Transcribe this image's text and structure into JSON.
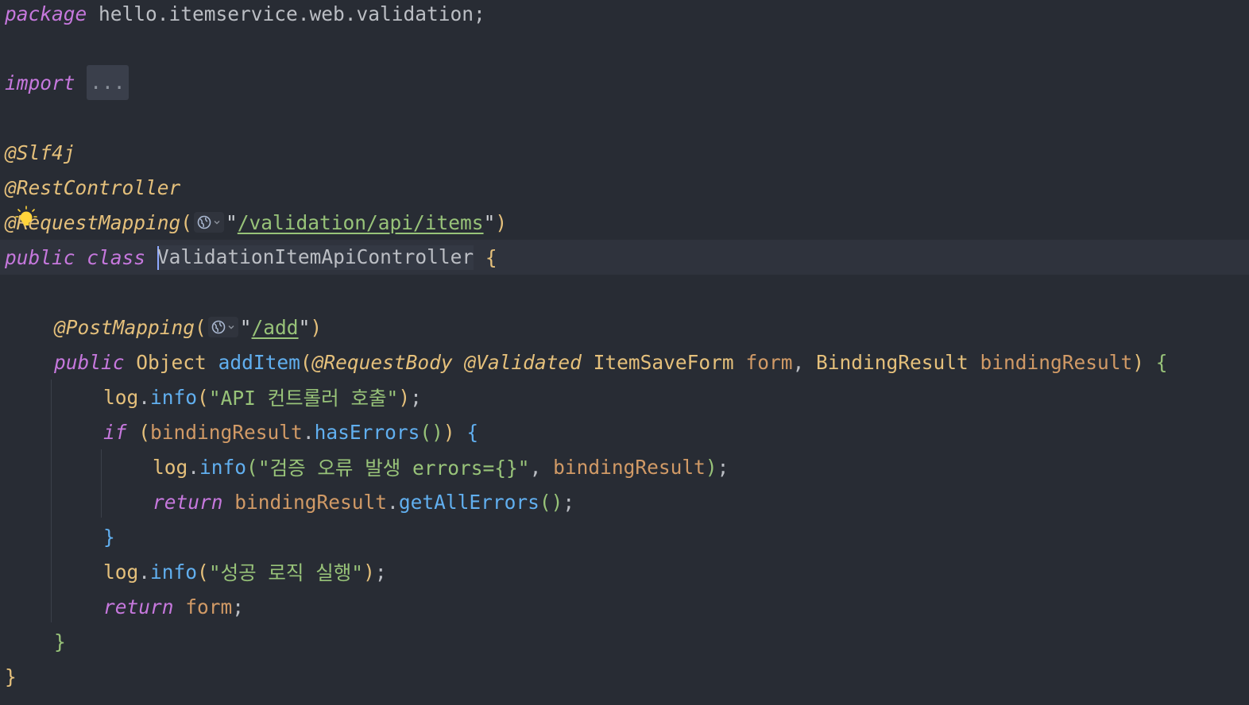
{
  "code": {
    "package_kw": "package",
    "package_name": " hello.itemservice.web.validation",
    "semicolon": ";",
    "import_kw": "import",
    "import_fold": "...",
    "anno_slf4j": "@Slf4j",
    "anno_rest": "@RestController",
    "anno_reqmap": "@RequestMapping",
    "reqmap_url": "/validation/api/items",
    "public_kw": "public",
    "class_kw": "class",
    "class_name": "ValidationItemApiController",
    "anno_postmap": "@PostMapping",
    "postmap_url": "/add",
    "return_type": "Object",
    "method_name": "addItem",
    "anno_requestbody": "@RequestBody",
    "anno_validated": "@Validated",
    "param_type1": "ItemSaveForm",
    "param_name1": "form",
    "param_type2": "BindingResult",
    "param_name2": "bindingResult",
    "log": "log",
    "info": "info",
    "str_api_call": "\"API 컨트롤러 호출\"",
    "if_kw": "if",
    "has_errors": "hasErrors",
    "str_error": "\"검증 오류 발생 errors={}\"",
    "return_kw": "return",
    "get_all_errors": "getAllErrors",
    "str_success": "\"성공 로직 실행\""
  },
  "colors": {
    "background": "#282c34",
    "keyword": "#c678dd",
    "annotation": "#e5c07b",
    "function": "#61afef",
    "string": "#98c379",
    "identifier": "#d19a66"
  },
  "icons": {
    "intention": "lightbulb-icon",
    "endpoint": "globe-icon"
  }
}
